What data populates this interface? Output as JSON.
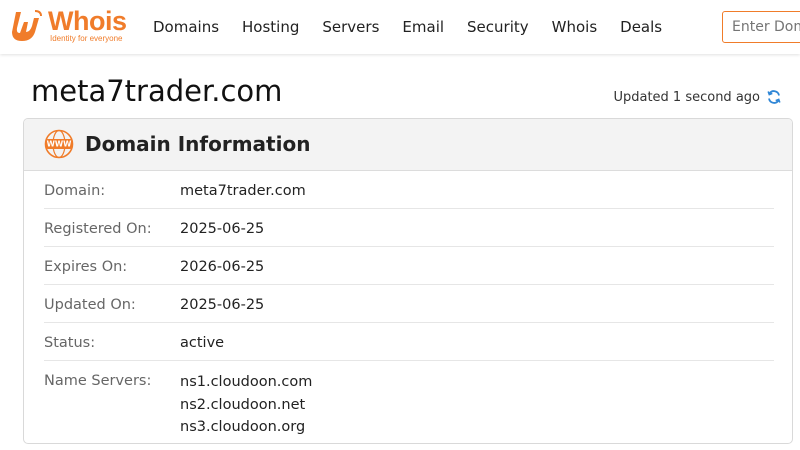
{
  "brand": {
    "name": "Whois",
    "tagline": "Identity for everyone",
    "color": "#f07c2a"
  },
  "nav": {
    "items": [
      "Domains",
      "Hosting",
      "Servers",
      "Email",
      "Security",
      "Whois",
      "Deals"
    ]
  },
  "search": {
    "placeholder": "Enter Domain or IP"
  },
  "page": {
    "title": "meta7trader.com",
    "updated_text": "Updated 1 second ago"
  },
  "card": {
    "title": "Domain Information",
    "icon": "www-icon",
    "rows": [
      {
        "label": "Domain:",
        "value": "meta7trader.com"
      },
      {
        "label": "Registered On:",
        "value": "2025-06-25"
      },
      {
        "label": "Expires On:",
        "value": "2026-06-25"
      },
      {
        "label": "Updated On:",
        "value": "2025-06-25"
      },
      {
        "label": "Status:",
        "value": "active"
      }
    ],
    "name_servers": {
      "label": "Name Servers:",
      "values": [
        "ns1.cloudoon.com",
        "ns2.cloudoon.net",
        "ns3.cloudoon.org"
      ]
    }
  }
}
